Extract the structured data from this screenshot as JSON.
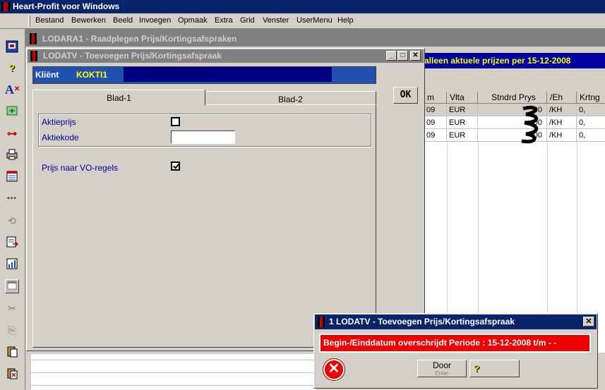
{
  "app": {
    "title": "Heart-Profit voor Windows",
    "menu": [
      "Bestand",
      "Bewerken",
      "Beeld",
      "Invoegen",
      "Opmaak",
      "Extra",
      "Grid",
      "Venster",
      "UserMenu",
      "Help"
    ]
  },
  "toolbar": {
    "icons": [
      "record-icon",
      "help-icon",
      "font-icon",
      "navigate-icon",
      "key-icon",
      "print-icon",
      "form-icon",
      "dots-icon",
      "refresh-icon",
      "export-icon",
      "chart-icon",
      "window-icon",
      "cut-icon",
      "copy-icon",
      "paste-icon",
      "paste-special-icon"
    ]
  },
  "back_window": {
    "title": "LODARA1 - Raadplegen Prijs/Kortingsafspraken",
    "banner": "alleen aktuele prijzen per 15-12-2008",
    "columns": [
      "m",
      "Vlta",
      "Stndrd Prys",
      "/Eh",
      "Krtng"
    ],
    "rows": [
      [
        "09",
        "EUR",
        "00",
        "/KH",
        "0,"
      ],
      [
        "09",
        "EUR",
        "00",
        "/KH",
        "0,"
      ],
      [
        "09",
        "EUR",
        "00",
        "/KH",
        "0,"
      ]
    ]
  },
  "front_window": {
    "title": "LODATV - Toevoegen Prijs/Kortingsafspraak",
    "client_label": "Kliënt",
    "client_code": "KOKTI1",
    "ok_label": "OK",
    "tabs": [
      "Blad-1",
      "Blad-2"
    ],
    "fields": {
      "aktieprijs_label": "Aktieprijs",
      "aktieprijs_checked": false,
      "aktiekode_label": "Aktiekode",
      "aktiekode_value": "",
      "vo_label": "Prijs naar VO-regels",
      "vo_checked": true
    }
  },
  "dialog": {
    "title": "1 LODATV - Toevoegen Prijs/Kortingsafspraak",
    "message": "Begin-/Einddatum overschrijdt Periode : 15-12-2008 t/m   -  -",
    "door_label": "Door",
    "door_sub": "Enter",
    "help_symbol": "?"
  }
}
